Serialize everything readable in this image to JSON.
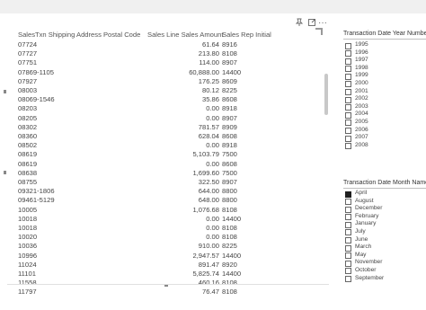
{
  "table": {
    "headers": [
      "SalesTxn Shipping Address Postal Code",
      "Sales Line Sales Amount",
      "Sales Rep Initial"
    ],
    "rows": [
      [
        "07724",
        "61.64",
        "8916"
      ],
      [
        "07727",
        "213.80",
        "8108"
      ],
      [
        "07751",
        "114.00",
        "8907"
      ],
      [
        "07869-1105",
        "60,888.00",
        "14400"
      ],
      [
        "07927",
        "176.25",
        "8609"
      ],
      [
        "08003",
        "80.12",
        "8225"
      ],
      [
        "08069-1546",
        "35.86",
        "8608"
      ],
      [
        "08203",
        "0.00",
        "8918"
      ],
      [
        "08205",
        "0.00",
        "8907"
      ],
      [
        "08302",
        "781.57",
        "8909"
      ],
      [
        "08360",
        "628.04",
        "8608"
      ],
      [
        "08502",
        "0.00",
        "8918"
      ],
      [
        "08619",
        "5,103.79",
        "7500"
      ],
      [
        "08619",
        "0.00",
        "8608"
      ],
      [
        "08638",
        "1,699.60",
        "7500"
      ],
      [
        "08755",
        "322.50",
        "8907"
      ],
      [
        "09321-1806",
        "644.00",
        "8800"
      ],
      [
        "09461-5129",
        "648.00",
        "8800"
      ],
      [
        "10005",
        "1,076.68",
        "8108"
      ],
      [
        "10018",
        "0.00",
        "14400"
      ],
      [
        "10018",
        "0.00",
        "8108"
      ],
      [
        "10020",
        "0.00",
        "8108"
      ],
      [
        "10036",
        "910.00",
        "8225"
      ],
      [
        "10996",
        "2,947.57",
        "14400"
      ],
      [
        "11024",
        "891.47",
        "8920"
      ],
      [
        "11101",
        "5,825.74",
        "14400"
      ],
      [
        "11558",
        "460.16",
        "8108"
      ],
      [
        "11797",
        "76.47",
        "8108"
      ]
    ]
  },
  "slicer_year": {
    "title": "Transaction Date Year Number",
    "items": [
      "1995",
      "1996",
      "1997",
      "1998",
      "1999",
      "2000",
      "2001",
      "2002",
      "2003",
      "2004",
      "2005",
      "2006",
      "2007",
      "2008"
    ]
  },
  "slicer_month": {
    "title": "Transaction Date Month Name",
    "items": [
      "April",
      "August",
      "December",
      "February",
      "January",
      "July",
      "June",
      "March",
      "May",
      "November",
      "October",
      "September"
    ],
    "checked": "April"
  },
  "icons": {
    "pin": "pin-icon",
    "focus": "focus-mode-icon",
    "more": "more-options-icon"
  }
}
